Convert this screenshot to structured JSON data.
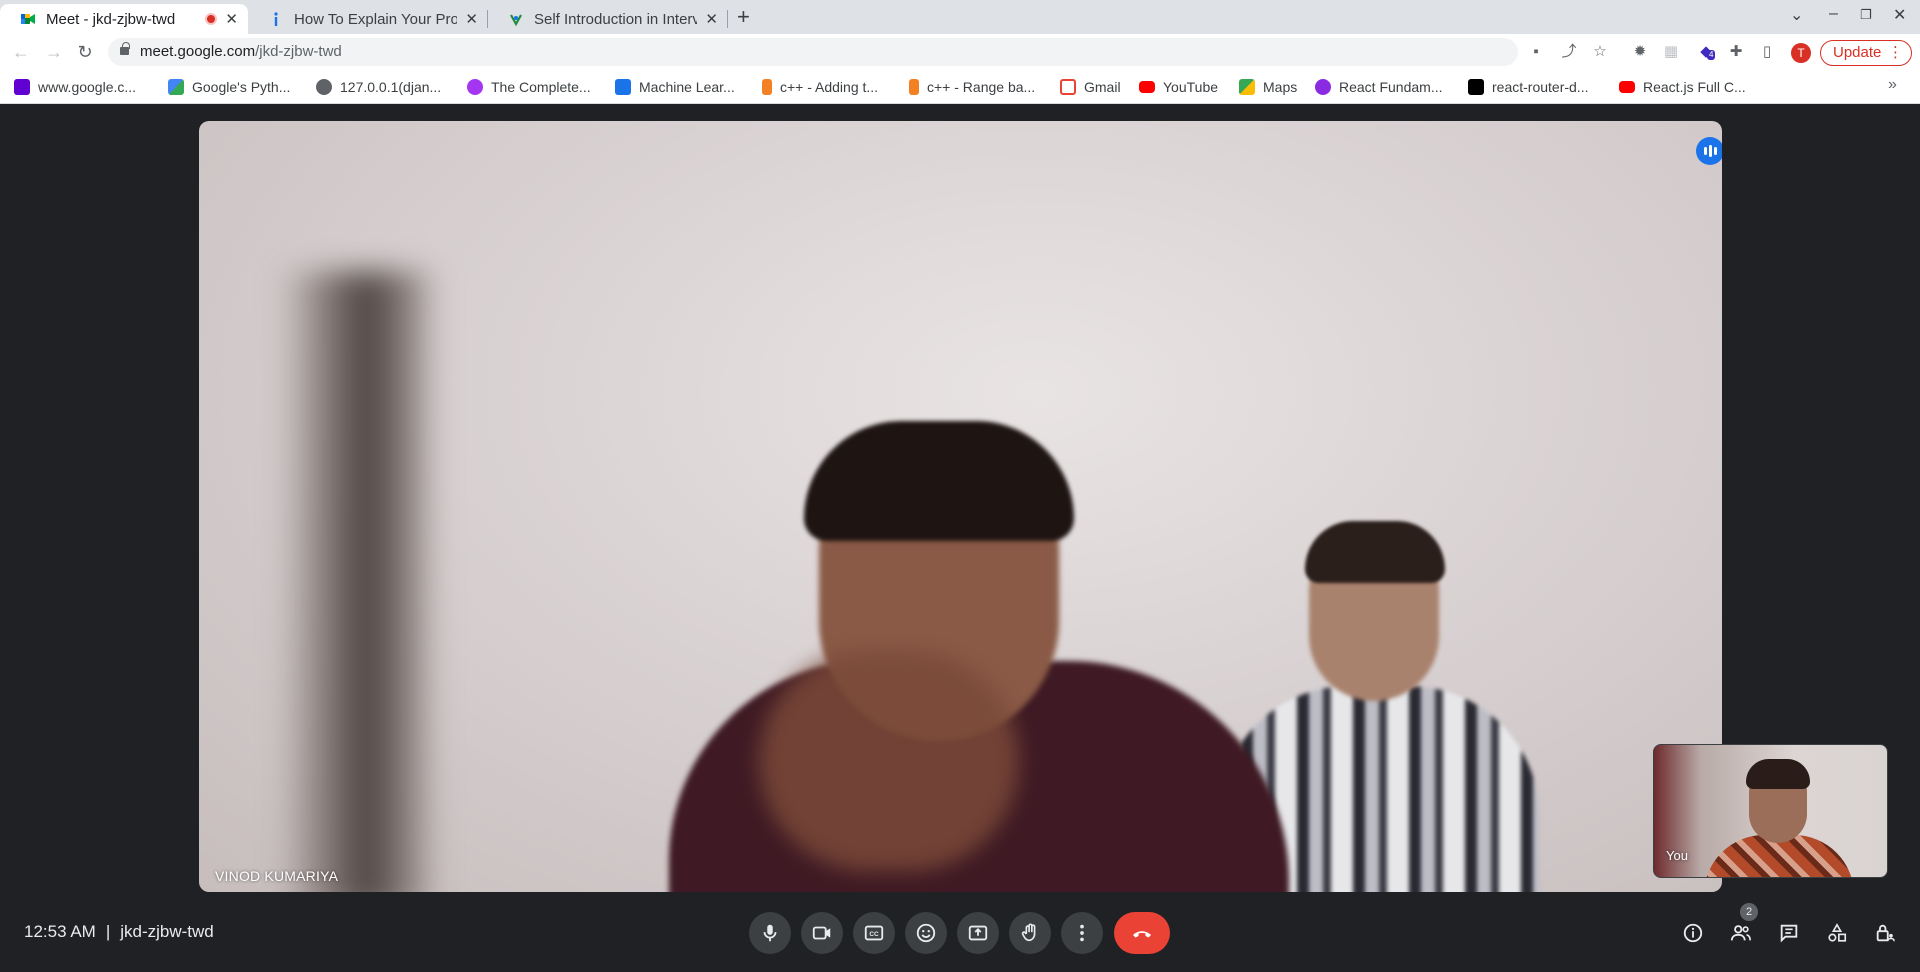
{
  "browser": {
    "tabs": [
      {
        "title": "Meet - jkd-zjbw-twd",
        "recording": true
      },
      {
        "title": "How To Explain Your Proj"
      },
      {
        "title": "Self Introduction in Interv"
      }
    ],
    "url_host": "meet.google.com",
    "url_path": "/jkd-zjbw-twd",
    "profile_initial": "T",
    "update_label": "Update",
    "extension_badge": "4",
    "bookmarks": [
      {
        "label": "www.google.c...",
        "icon": "yahoo-icon",
        "color": "#6001d2"
      },
      {
        "label": "Google's Pyth...",
        "icon": "google-dev-icon",
        "color": "#4285f4"
      },
      {
        "label": "127.0.0.1(djan...",
        "icon": "globe-icon",
        "color": "#5f6368"
      },
      {
        "label": "The Complete...",
        "icon": "udemy-icon",
        "color": "#a435f0"
      },
      {
        "label": "Machine Lear...",
        "icon": "js-icon",
        "color": "#1a73e8"
      },
      {
        "label": "c++ - Adding t...",
        "icon": "stackoverflow-icon",
        "color": "#f48024"
      },
      {
        "label": "c++ - Range ba...",
        "icon": "stackoverflow-icon",
        "color": "#f48024"
      },
      {
        "label": "Gmail",
        "icon": "gmail-icon",
        "color": "#ea4335"
      },
      {
        "label": "YouTube",
        "icon": "youtube-icon",
        "color": "#ff0000"
      },
      {
        "label": "Maps",
        "icon": "maps-icon",
        "color": "#34a853"
      },
      {
        "label": "React Fundam...",
        "icon": "react-icon",
        "color": "#8a2be2"
      },
      {
        "label": "react-router-d...",
        "icon": "dev-icon",
        "color": "#000000"
      },
      {
        "label": "React.js Full C...",
        "icon": "youtube-icon",
        "color": "#ff0000"
      }
    ]
  },
  "meet": {
    "main_participant_name": "VINOD KUMARIYA",
    "self_label": "You",
    "time": "12:53 AM",
    "separator": "|",
    "meeting_code": "jkd-zjbw-twd",
    "participant_count": "2"
  },
  "colors": {
    "accent": "#1a73e8",
    "end_call": "#ea4335",
    "control_bg": "#3c4043",
    "stage_bg": "#202124"
  }
}
